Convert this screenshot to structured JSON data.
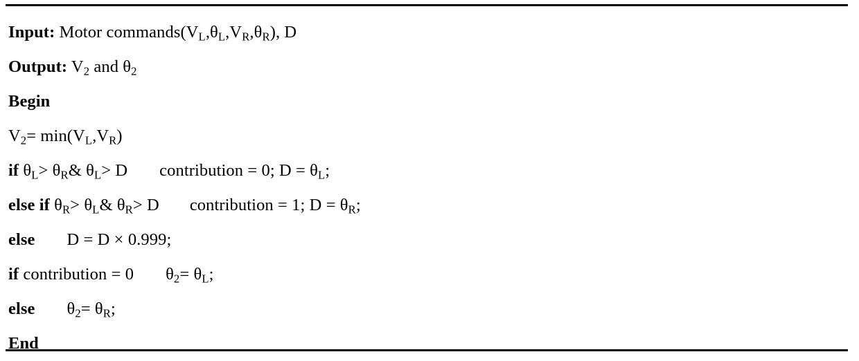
{
  "document": {
    "type": "algorithm-pseudocode-block",
    "clipped_header_text": "",
    "rules": {
      "top": "solid-black-rule",
      "bottom": "solid-black-rule"
    }
  },
  "lines": [
    {
      "id": "input",
      "keyword": "Input:",
      "body_prefix": " Motor commands(V",
      "sub1": "L",
      "mid1": ",θ",
      "sub2": "L",
      "mid2": ",V",
      "sub3": "R",
      "mid3": ",θ",
      "sub4": "R",
      "tail": "), D"
    },
    {
      "id": "output",
      "keyword": "Output:",
      "body_prefix": " V",
      "sub1": "2",
      "mid1": " and θ",
      "sub2": "2",
      "tail": ""
    },
    {
      "id": "begin",
      "keyword": "Begin"
    },
    {
      "id": "assign-v2",
      "lhs": "V",
      "sub1": "2",
      "mid1": "= min(V",
      "sub2": "L",
      "mid2": ",V",
      "sub3": "R",
      "tail": ")"
    },
    {
      "id": "if-theta-l",
      "keyword": "if",
      "cond_a": " θ",
      "sub1": "L",
      "cond_b": "> θ",
      "sub2": "R",
      "cond_c": "& θ",
      "sub3": "L",
      "cond_d": "> D",
      "stmt_a": "contribution = 0; D = θ",
      "sub4": "L",
      "stmt_b": ";"
    },
    {
      "id": "else-if-theta-r",
      "keyword": "else if",
      "cond_a": " θ",
      "sub1": "R",
      "cond_b": "> θ",
      "sub2": "L",
      "cond_c": "& θ",
      "sub3": "R",
      "cond_d": "> D",
      "stmt_a": "contribution = 1; D = θ",
      "sub4": "R",
      "stmt_b": ";"
    },
    {
      "id": "else-decay",
      "keyword": "else",
      "stmt": "D = D × 0.999;"
    },
    {
      "id": "if-contribution-zero",
      "keyword": "if",
      "cond": " contribution = 0",
      "stmt_a": "θ",
      "sub1": "2",
      "stmt_b": "= θ",
      "sub2": "L",
      "stmt_c": ";"
    },
    {
      "id": "else-theta-r",
      "keyword": "else",
      "stmt_a": "θ",
      "sub1": "2",
      "stmt_b": "= θ",
      "sub2": "R",
      "stmt_c": ";"
    },
    {
      "id": "end",
      "keyword": "End"
    }
  ]
}
